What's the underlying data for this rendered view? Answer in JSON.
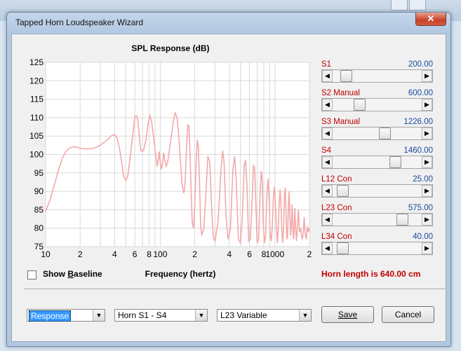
{
  "window": {
    "title": "Tapped Horn Loudspeaker Wizard",
    "close_glyph": "✕"
  },
  "chart_data": {
    "type": "line",
    "title": "SPL Response (dB)",
    "xlabel": "Frequency (hertz)",
    "ylabel": "",
    "x_scale": "log",
    "xlim": [
      10,
      2000
    ],
    "ylim": [
      75,
      125
    ],
    "y_ticks": [
      "125",
      "120",
      "115",
      "110",
      "105",
      "100",
      "95",
      "90",
      "85",
      "80",
      "75"
    ],
    "x_tick_labels": [
      {
        "v": 10,
        "t": "10"
      },
      {
        "v": 20,
        "t": "2"
      },
      {
        "v": 40,
        "t": "4"
      },
      {
        "v": 60,
        "t": "6"
      },
      {
        "v": 80,
        "t": "8"
      },
      {
        "v": 100,
        "t": "100"
      },
      {
        "v": 200,
        "t": "2"
      },
      {
        "v": 400,
        "t": "4"
      },
      {
        "v": 600,
        "t": "6"
      },
      {
        "v": 800,
        "t": "8"
      },
      {
        "v": 1000,
        "t": "1000"
      },
      {
        "v": 2000,
        "t": "2"
      }
    ],
    "grid": true,
    "series": [
      {
        "color": "#f4a8a8",
        "points": [
          [
            10,
            84.5
          ],
          [
            11,
            88
          ],
          [
            12,
            92
          ],
          [
            13,
            96
          ],
          [
            14,
            99
          ],
          [
            15,
            100.8
          ],
          [
            16,
            101.7
          ],
          [
            17,
            102
          ],
          [
            18,
            102.1
          ],
          [
            20,
            101.7
          ],
          [
            22,
            101.5
          ],
          [
            25,
            101.6
          ],
          [
            28,
            102
          ],
          [
            30,
            102.5
          ],
          [
            33,
            103.5
          ],
          [
            36,
            104.5
          ],
          [
            38,
            105.2
          ],
          [
            40,
            105.4
          ],
          [
            42,
            104.5
          ],
          [
            44,
            102
          ],
          [
            46,
            98
          ],
          [
            48,
            94
          ],
          [
            50,
            93
          ],
          [
            52,
            94
          ],
          [
            55,
            100
          ],
          [
            58,
            106
          ],
          [
            60,
            110.2
          ],
          [
            62,
            110.5
          ],
          [
            64,
            109
          ],
          [
            66,
            104
          ],
          [
            68,
            101
          ],
          [
            70,
            100.8
          ],
          [
            72,
            101.5
          ],
          [
            75,
            104
          ],
          [
            78,
            108
          ],
          [
            81,
            110.5
          ],
          [
            84,
            109
          ],
          [
            88,
            104
          ],
          [
            92,
            99
          ],
          [
            94,
            96.7
          ],
          [
            96,
            98.5
          ],
          [
            98,
            100.8
          ],
          [
            100,
            98
          ],
          [
            102,
            96
          ],
          [
            104,
            97
          ],
          [
            107,
            100.5
          ],
          [
            110,
            98
          ],
          [
            113,
            96.8
          ],
          [
            116,
            98
          ],
          [
            120,
            101
          ],
          [
            125,
            105
          ],
          [
            130,
            109
          ],
          [
            135,
            111.3
          ],
          [
            140,
            110
          ],
          [
            145,
            105
          ],
          [
            150,
            98
          ],
          [
            155,
            92
          ],
          [
            160,
            89.5
          ],
          [
            163,
            90.5
          ],
          [
            166,
            95
          ],
          [
            170,
            103
          ],
          [
            174,
            108
          ],
          [
            178,
            107.7
          ],
          [
            182,
            100
          ],
          [
            186,
            90
          ],
          [
            190,
            81.5
          ],
          [
            195,
            80
          ],
          [
            200,
            86
          ],
          [
            205,
            97
          ],
          [
            210,
            104
          ],
          [
            215,
            102
          ],
          [
            220,
            92
          ],
          [
            225,
            80.5
          ],
          [
            230,
            78
          ],
          [
            240,
            80
          ],
          [
            250,
            89
          ],
          [
            260,
            99.5
          ],
          [
            270,
            98
          ],
          [
            280,
            86
          ],
          [
            290,
            77.5
          ],
          [
            300,
            76.5
          ],
          [
            320,
            82
          ],
          [
            340,
            97
          ],
          [
            350,
            101
          ],
          [
            360,
            98
          ],
          [
            375,
            83
          ],
          [
            390,
            77
          ],
          [
            410,
            80
          ],
          [
            430,
            96
          ],
          [
            445,
            99.5
          ],
          [
            460,
            93
          ],
          [
            480,
            77
          ],
          [
            500,
            76
          ],
          [
            520,
            83
          ],
          [
            540,
            97
          ],
          [
            555,
            98.5
          ],
          [
            570,
            92
          ],
          [
            590,
            76.5
          ],
          [
            610,
            77
          ],
          [
            630,
            86
          ],
          [
            650,
            97
          ],
          [
            665,
            96.5
          ],
          [
            680,
            88
          ],
          [
            700,
            76
          ],
          [
            720,
            77
          ],
          [
            740,
            88
          ],
          [
            760,
            95.5
          ],
          [
            775,
            93
          ],
          [
            790,
            82
          ],
          [
            810,
            76
          ],
          [
            830,
            78
          ],
          [
            850,
            89
          ],
          [
            870,
            93.5
          ],
          [
            890,
            88
          ],
          [
            910,
            78
          ],
          [
            930,
            76.5
          ],
          [
            950,
            81
          ],
          [
            970,
            88
          ],
          [
            990,
            91.2
          ],
          [
            1010,
            87
          ],
          [
            1030,
            80
          ],
          [
            1050,
            76
          ],
          [
            1070,
            80
          ],
          [
            1090,
            87
          ],
          [
            1110,
            90.5
          ],
          [
            1130,
            86
          ],
          [
            1150,
            79
          ],
          [
            1170,
            76
          ],
          [
            1190,
            80
          ],
          [
            1210,
            89
          ],
          [
            1230,
            91
          ],
          [
            1250,
            85
          ],
          [
            1270,
            77
          ],
          [
            1290,
            78
          ],
          [
            1310,
            86
          ],
          [
            1330,
            90
          ],
          [
            1350,
            84
          ],
          [
            1370,
            78
          ],
          [
            1390,
            80
          ],
          [
            1410,
            86.5
          ],
          [
            1430,
            82
          ],
          [
            1450,
            77
          ],
          [
            1470,
            79
          ],
          [
            1490,
            85.5
          ],
          [
            1510,
            81
          ],
          [
            1540,
            76.5
          ],
          [
            1570,
            80
          ],
          [
            1600,
            85
          ],
          [
            1640,
            79
          ],
          [
            1680,
            80
          ],
          [
            1720,
            77
          ],
          [
            1760,
            78
          ],
          [
            1800,
            83
          ],
          [
            1840,
            78
          ],
          [
            1880,
            77
          ],
          [
            1920,
            80.5
          ],
          [
            1960,
            79
          ],
          [
            2000,
            80
          ]
        ]
      }
    ]
  },
  "baseline": {
    "label_pre": "Show ",
    "label_key": "B",
    "label_post": "aseline",
    "checked": false
  },
  "sliders": [
    {
      "name": "S1",
      "value": "200.00",
      "pos": 0.1
    },
    {
      "name": "S2  Manual",
      "value": "600.00",
      "pos": 0.27
    },
    {
      "name": "S3  Manual",
      "value": "1226.00",
      "pos": 0.6
    },
    {
      "name": "S4",
      "value": "1460.00",
      "pos": 0.74
    },
    {
      "name": "L12  Con",
      "value": "25.00",
      "pos": 0.05
    },
    {
      "name": "L23  Con",
      "value": "575.00",
      "pos": 0.83
    },
    {
      "name": "L34  Con",
      "value": "40.00",
      "pos": 0.05
    }
  ],
  "horn_length": "Horn length is 640.00 cm",
  "bottom": {
    "combo1": "Response",
    "combo2": "Horn S1 - S4",
    "combo3": "L23 Variable",
    "dropdown_glyph": "▼",
    "save": "Save",
    "cancel": "Cancel"
  },
  "arrows": {
    "left": "◀",
    "right": "▶"
  }
}
